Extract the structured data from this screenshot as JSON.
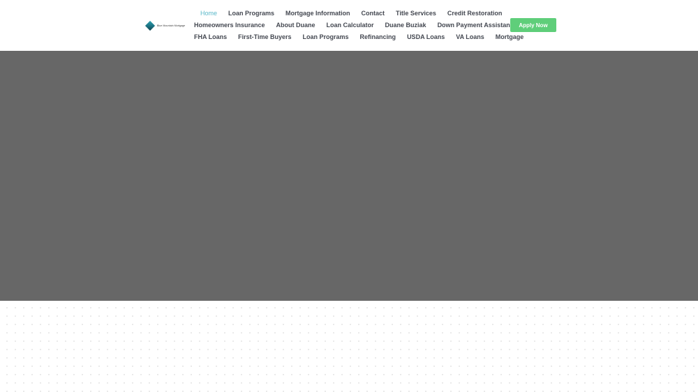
{
  "logo": {
    "text": "Blue Mountain Mortgage"
  },
  "nav": {
    "row1": [
      "Home",
      "Loan Programs",
      "Mortgage Information",
      "Contact",
      "Title Services",
      "Credit Restoration"
    ],
    "row2": [
      "Homeowners Insurance",
      "About Duane",
      "Loan Calculator",
      "Duane Buziak",
      "Down Payment Assistance"
    ],
    "row3": [
      "FHA Loans",
      "First-Time Buyers",
      "Loan Programs",
      "Refinancing",
      "USDA Loans",
      "VA Loans",
      "Mortgage"
    ],
    "active": "Home"
  },
  "cta": {
    "label": "Apply Now"
  },
  "colors": {
    "accent_active": "#5ab8c9",
    "cta_bg": "#5fce7a",
    "hero_bg": "#676767",
    "nav_text": "#444851"
  }
}
